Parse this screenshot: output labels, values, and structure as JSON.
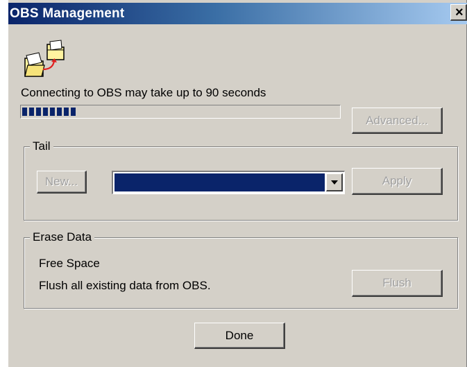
{
  "window": {
    "title": "OBS Management",
    "close_glyph": "×",
    "app_icon": "folders-transfer-icon"
  },
  "connection": {
    "status_text": "Connecting to OBS may take up to 90 seconds",
    "progress_fraction": 0.19,
    "advanced_label": "Advanced..."
  },
  "tail": {
    "legend": "Tail",
    "new_label": "New...",
    "selected_value": "",
    "apply_label": "Apply"
  },
  "erase": {
    "legend": "Erase Data",
    "free_space_label": "Free Space",
    "description": "Flush all existing data from OBS.",
    "flush_label": "Flush"
  },
  "footer": {
    "done_label": "Done"
  },
  "colors": {
    "title_bar_start": "#0a246a",
    "title_bar_end": "#a6caf0",
    "dialog_face": "#d4d0c8",
    "selection": "#0a246a",
    "progress": "#0a246a",
    "disabled_text": "#a0a0a0"
  }
}
